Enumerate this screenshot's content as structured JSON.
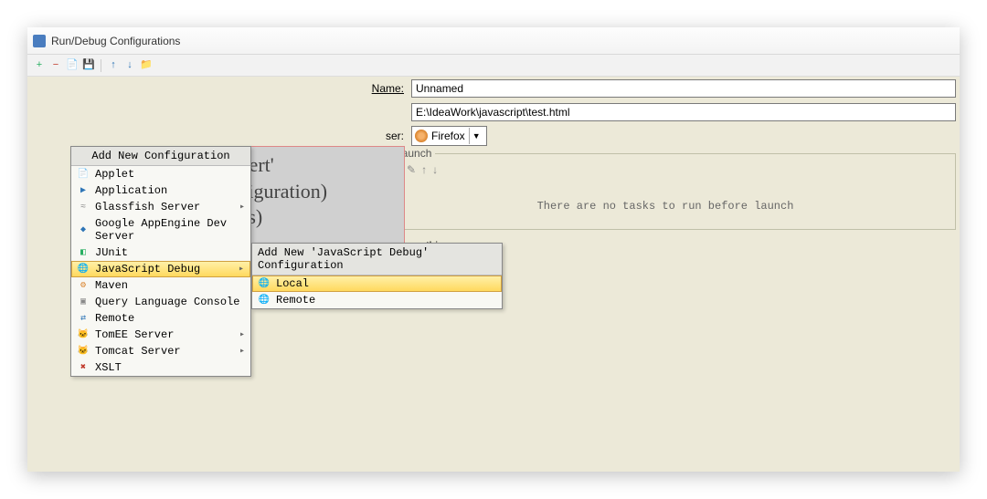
{
  "window": {
    "title": "Run/Debug Configurations"
  },
  "toolbar_icons": {
    "add": "+",
    "remove": "−",
    "copy": "📄",
    "save": "💾",
    "up": "↑",
    "down": "↓",
    "folder": "📁"
  },
  "fields": {
    "name_label": "Name:",
    "name_value": "Unnamed",
    "html_value": "E:\\IdeaWork\\javascript\\test.html",
    "browser_label_suffix": "ser:",
    "browser_value": "Firefox"
  },
  "before_launch": {
    "legend_suffix": "re launch",
    "empty_text": "There are no tasks to run before launch"
  },
  "show_page_label": "Show this page",
  "hint_fragment": {
    "line1": "sert'",
    "line2": "figuration)",
    "line3": "(s)"
  },
  "config_menu": {
    "header": "Add New Configuration",
    "items": [
      {
        "label": "Applet",
        "icon": "📄",
        "cls": "c-blue"
      },
      {
        "label": "Application",
        "icon": "▶",
        "cls": "c-blue"
      },
      {
        "label": "Glassfish Server",
        "icon": "≈",
        "cls": "c-gray",
        "sub": true
      },
      {
        "label": "Google AppEngine Dev Server",
        "icon": "◆",
        "cls": "c-blue"
      },
      {
        "label": "JUnit",
        "icon": "◧",
        "cls": "c-green"
      },
      {
        "label": "JavaScript Debug",
        "icon": "🌐",
        "cls": "c-blue",
        "sub": true,
        "sel": true
      },
      {
        "label": "Maven",
        "icon": "⚙",
        "cls": "c-orange"
      },
      {
        "label": "Query Language Console",
        "icon": "▣",
        "cls": "c-gray"
      },
      {
        "label": "Remote",
        "icon": "⇄",
        "cls": "c-blue"
      },
      {
        "label": "TomEE Server",
        "icon": "🐱",
        "cls": "c-gold",
        "sub": true
      },
      {
        "label": "Tomcat Server",
        "icon": "🐱",
        "cls": "c-gold",
        "sub": true
      },
      {
        "label": "XSLT",
        "icon": "✖",
        "cls": "c-red"
      }
    ]
  },
  "sub_menu": {
    "header": "Add New 'JavaScript Debug' Configuration",
    "items": [
      {
        "label": "Local",
        "icon": "🌐",
        "sel": true
      },
      {
        "label": "Remote",
        "icon": "🌐"
      }
    ]
  }
}
